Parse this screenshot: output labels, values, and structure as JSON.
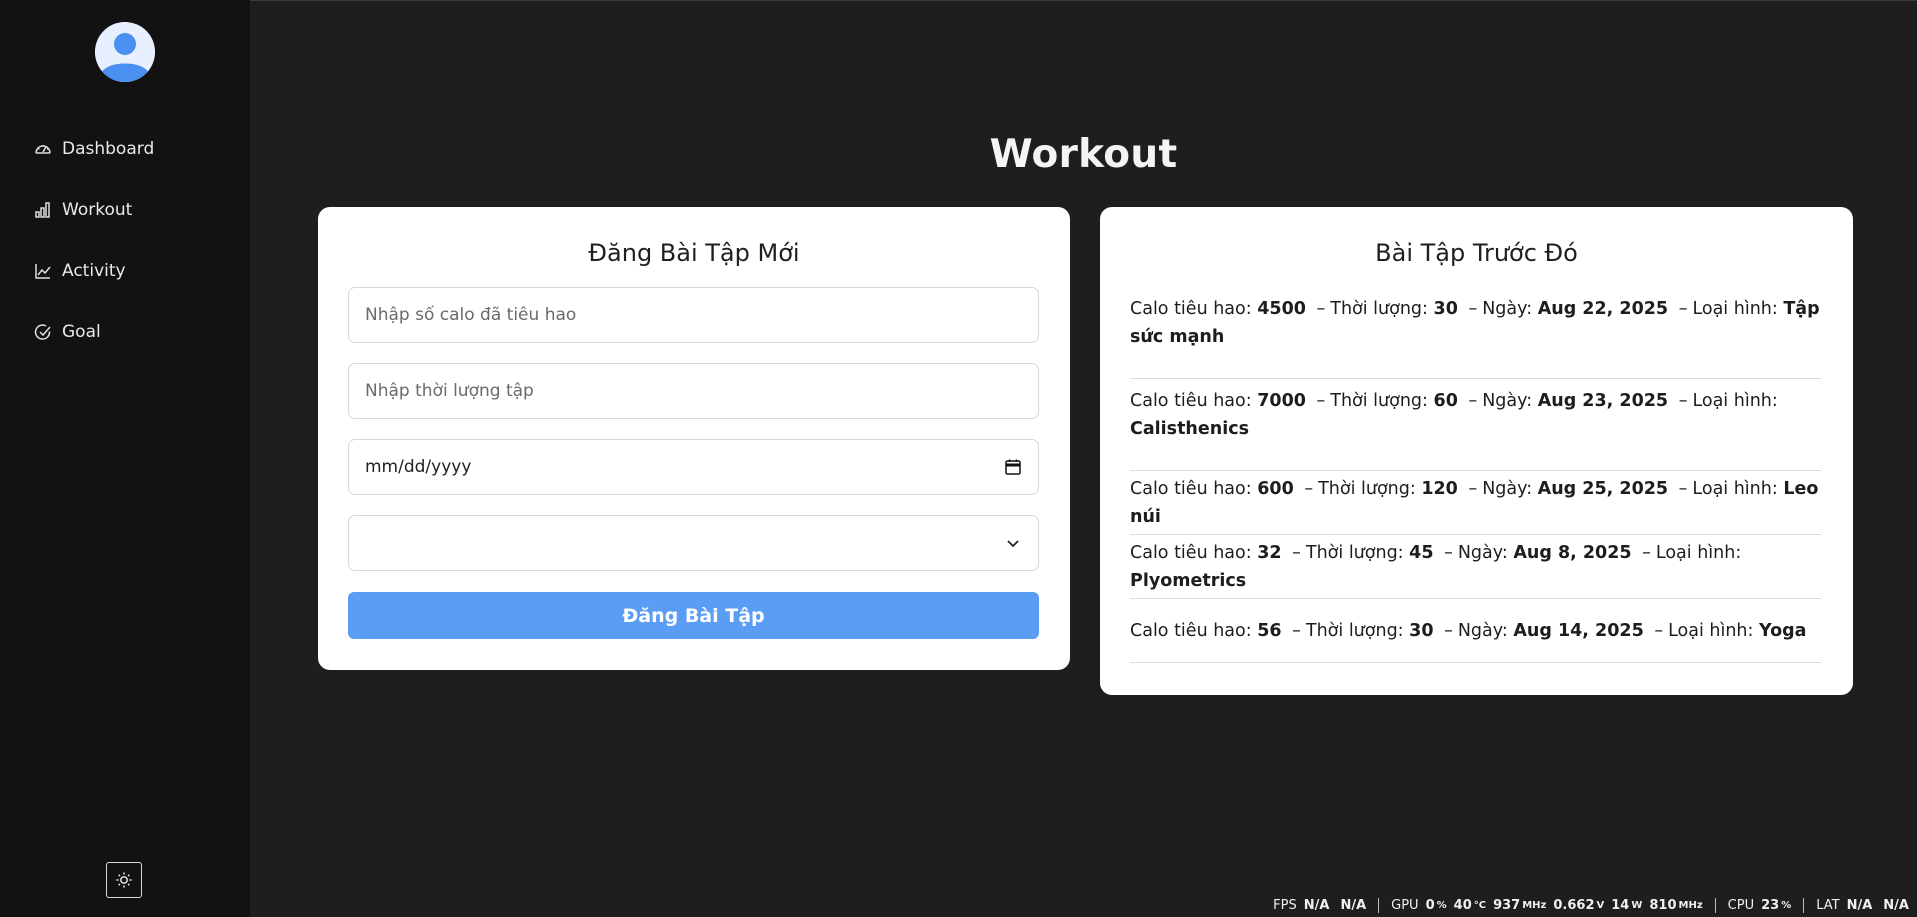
{
  "page": {
    "title": "Workout"
  },
  "sidebar": {
    "items": [
      {
        "label": "Dashboard",
        "icon": "gauge-icon"
      },
      {
        "label": "Workout",
        "icon": "bar-chart-icon"
      },
      {
        "label": "Activity",
        "icon": "line-chart-icon"
      },
      {
        "label": "Goal",
        "icon": "check-circle-icon"
      }
    ],
    "theme_toggle_icon": "sun-icon"
  },
  "form": {
    "title": "Đăng Bài Tập Mới",
    "calories_placeholder": "Nhập số calo đã tiêu hao",
    "duration_placeholder": "Nhập thời lượng tập",
    "date_placeholder": "mm/dd/yyyy",
    "type_value": "",
    "submit_label": "Đăng Bài Tập"
  },
  "history": {
    "title": "Bài Tập Trước Đó",
    "labels": {
      "calories": "Calo tiêu hao:",
      "duration": "Thời lượng:",
      "date": "Ngày:",
      "type": "Loại hình:",
      "sep": "–"
    },
    "entries": [
      {
        "calories": "4500",
        "duration": "30",
        "date": "Aug 22, 2025",
        "type": "Tập sức mạnh"
      },
      {
        "calories": "7000",
        "duration": "60",
        "date": "Aug 23, 2025",
        "type": "Calisthenics"
      },
      {
        "calories": "600",
        "duration": "120",
        "date": "Aug 25, 2025",
        "type": "Leo núi"
      },
      {
        "calories": "32",
        "duration": "45",
        "date": "Aug 8, 2025",
        "type": "Plyometrics"
      },
      {
        "calories": "56",
        "duration": "30",
        "date": "Aug 14, 2025",
        "type": "Yoga"
      }
    ]
  },
  "statusbar": {
    "fps": {
      "label": "FPS",
      "v1": "N/A",
      "v2": "N/A"
    },
    "gpu": {
      "label": "GPU",
      "load": "0",
      "load_unit": "%",
      "temp": "40",
      "temp_unit": "°C",
      "clock": "937",
      "clock_unit": "MHz",
      "volt": "0.662",
      "volt_unit": "V",
      "power": "14",
      "power_unit": "W",
      "mem_clock": "810",
      "mem_unit": "MHz"
    },
    "cpu": {
      "label": "CPU",
      "load": "23",
      "load_unit": "%"
    },
    "lat": {
      "label": "LAT",
      "v1": "N/A",
      "v2": "N/A"
    }
  },
  "colors": {
    "accent": "#5b9cf5",
    "sidebar_bg": "#121212",
    "page_bg": "#1e1e1e",
    "card_bg": "#ffffff"
  }
}
